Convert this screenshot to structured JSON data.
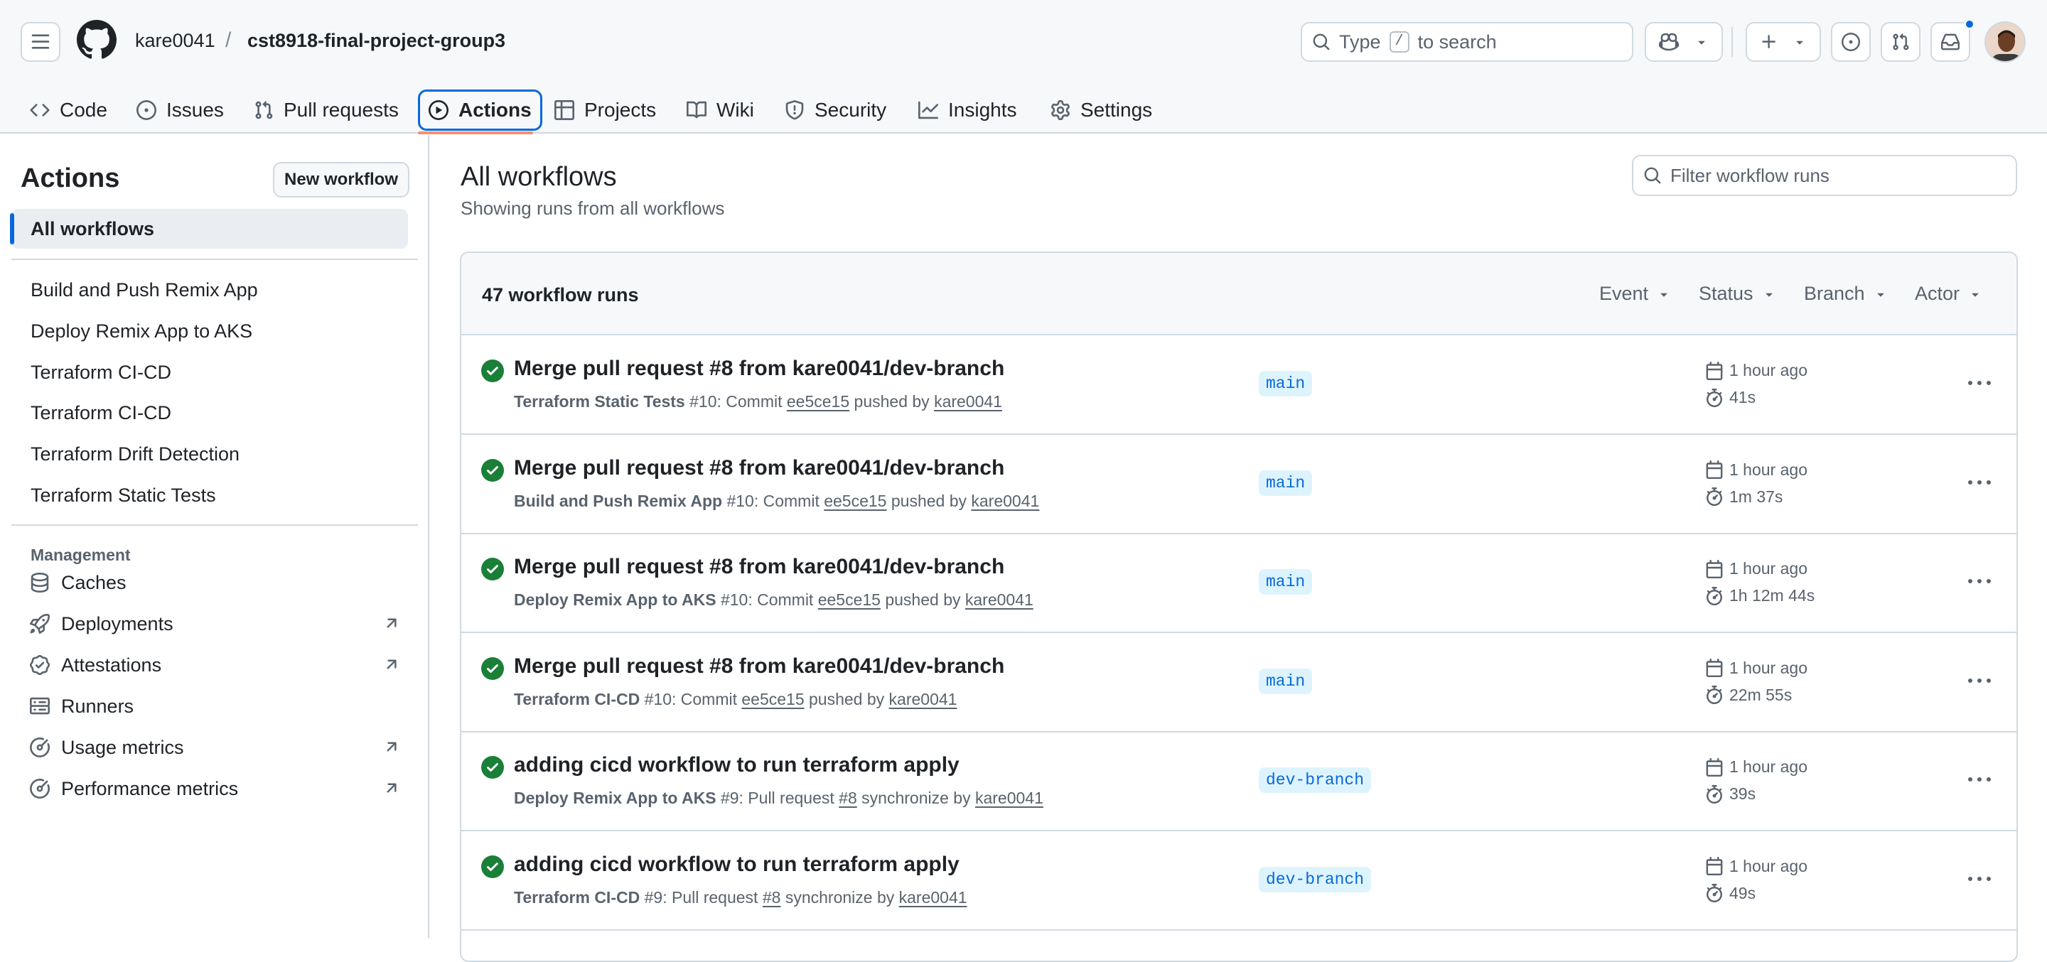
{
  "repo": {
    "owner": "kare0041",
    "separator": "/",
    "name": "cst8918-final-project-group3"
  },
  "search": {
    "prefix": "Type",
    "key": "/",
    "suffix": "to search"
  },
  "tabs": [
    {
      "label": "Code",
      "icon": "code-icon"
    },
    {
      "label": "Issues",
      "icon": "issue-opened-icon"
    },
    {
      "label": "Pull requests",
      "icon": "git-pull-request-icon"
    },
    {
      "label": "Actions",
      "icon": "play-icon"
    },
    {
      "label": "Projects",
      "icon": "table-icon"
    },
    {
      "label": "Wiki",
      "icon": "book-icon"
    },
    {
      "label": "Security",
      "icon": "shield-icon"
    },
    {
      "label": "Insights",
      "icon": "graph-icon"
    },
    {
      "label": "Settings",
      "icon": "gear-icon"
    }
  ],
  "sidebar": {
    "title": "Actions",
    "new_workflow": "New workflow",
    "all_workflows": "All workflows",
    "workflows": [
      "Build and Push Remix App",
      "Deploy Remix App to AKS",
      "Terraform CI-CD",
      "Terraform CI-CD",
      "Terraform Drift Detection",
      "Terraform Static Tests"
    ],
    "management_heading": "Management",
    "management": [
      {
        "label": "Caches",
        "icon": "database-icon"
      },
      {
        "label": "Deployments",
        "icon": "rocket-icon"
      },
      {
        "label": "Attestations",
        "icon": "verified-icon"
      },
      {
        "label": "Runners",
        "icon": "server-icon"
      },
      {
        "label": "Usage metrics",
        "icon": "meter-icon"
      },
      {
        "label": "Performance metrics",
        "icon": "meter-icon"
      }
    ]
  },
  "main": {
    "title": "All workflows",
    "subtitle": "Showing runs from all workflows",
    "filter_placeholder": "Filter workflow runs",
    "runs_count": "47 workflow runs",
    "filters": [
      "Event",
      "Status",
      "Branch",
      "Actor"
    ]
  },
  "runs": [
    {
      "title": "Merge pull request #8 from kare0041/dev-branch",
      "workflow": "Terraform Static Tests",
      "number": "#10",
      "sep": ": Commit ",
      "ref": "ee5ce15",
      "action": " pushed by ",
      "actor": "kare0041",
      "branch": "main",
      "time": "1 hour ago",
      "duration": "41s",
      "status": "success"
    },
    {
      "title": "Merge pull request #8 from kare0041/dev-branch",
      "workflow": "Build and Push Remix App",
      "number": "#10",
      "sep": ": Commit ",
      "ref": "ee5ce15",
      "action": " pushed by ",
      "actor": "kare0041",
      "branch": "main",
      "time": "1 hour ago",
      "duration": "1m 37s",
      "status": "success"
    },
    {
      "title": "Merge pull request #8 from kare0041/dev-branch",
      "workflow": "Deploy Remix App to AKS",
      "number": "#10",
      "sep": ": Commit ",
      "ref": "ee5ce15",
      "action": " pushed by ",
      "actor": "kare0041",
      "branch": "main",
      "time": "1 hour ago",
      "duration": "1h 12m 44s",
      "status": "success"
    },
    {
      "title": "Merge pull request #8 from kare0041/dev-branch",
      "workflow": "Terraform CI-CD",
      "number": "#10",
      "sep": ": Commit ",
      "ref": "ee5ce15",
      "action": " pushed by ",
      "actor": "kare0041",
      "branch": "main",
      "time": "1 hour ago",
      "duration": "22m 55s",
      "status": "success"
    },
    {
      "title": "adding cicd workflow to run terraform apply",
      "workflow": "Deploy Remix App to AKS",
      "number": "#9",
      "sep": ": Pull request ",
      "ref": "#8",
      "action": " synchronize by ",
      "actor": "kare0041",
      "branch": "dev-branch",
      "time": "1 hour ago",
      "duration": "39s",
      "status": "success"
    },
    {
      "title": "adding cicd workflow to run terraform apply",
      "workflow": "Terraform CI-CD",
      "number": "#9",
      "sep": ": Pull request ",
      "ref": "#8",
      "action": " synchronize by ",
      "actor": "kare0041",
      "branch": "dev-branch",
      "time": "1 hour ago",
      "duration": "49s",
      "status": "success"
    }
  ],
  "colors": {
    "accent": "#0969da",
    "success": "#1a7f37",
    "tab_underline": "#fd8c73"
  }
}
